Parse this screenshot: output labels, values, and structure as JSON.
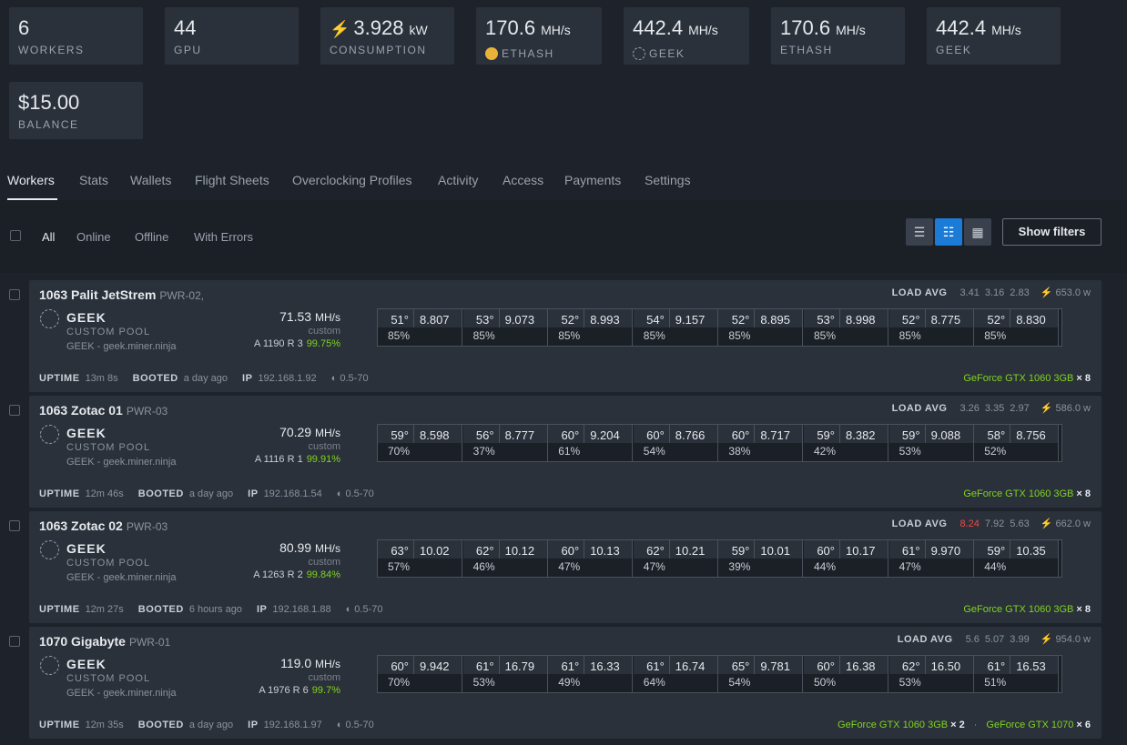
{
  "stats": [
    {
      "value": "6",
      "unit": "",
      "label": "WORKERS",
      "icon": ""
    },
    {
      "value": "44",
      "unit": "",
      "label": "GPU",
      "icon": ""
    },
    {
      "value": "3.928",
      "unit": "kW",
      "label": "CONSUMPTION",
      "icon": "bolt-icon"
    },
    {
      "value": "170.6",
      "unit": "MH/s",
      "label": "ETHASH",
      "icon": "ethash-coin-icon"
    },
    {
      "value": "442.4",
      "unit": "MH/s",
      "label": "GEEK",
      "icon": "geek-coin-icon"
    },
    {
      "value": "170.6",
      "unit": "MH/s",
      "label": "ETHASH",
      "icon": ""
    },
    {
      "value": "442.4",
      "unit": "MH/s",
      "label": "GEEK",
      "icon": ""
    },
    {
      "value": "$15.00",
      "unit": "",
      "label": "BALANCE",
      "icon": ""
    }
  ],
  "tabs": [
    "Workers",
    "Stats",
    "Wallets",
    "Flight Sheets",
    "Overclocking Profiles",
    "Activity",
    "Access",
    "Payments",
    "Settings"
  ],
  "filters": [
    "All",
    "Online",
    "Offline",
    "With Errors"
  ],
  "show_filters_label": "Show filters",
  "labels": {
    "load_avg": "LOAD AVG",
    "uptime": "UPTIME",
    "booted": "BOOTED",
    "ip": "IP",
    "custom": "custom"
  },
  "workers": [
    {
      "name": "1063 Palit JetStrem",
      "tag": "PWR-02,",
      "coin": "GEEK",
      "pool": "CUSTOM POOL",
      "pool_url": "GEEK - geek.miner.ninja",
      "hashrate": "71.53",
      "hashrate_unit": "MH/s",
      "accepted": "A 1190",
      "rejected": "R 3",
      "ratio": "99.75%",
      "load": [
        "3.41",
        "3.16",
        "2.83"
      ],
      "load_high": [
        false,
        false,
        false
      ],
      "power": "653.0 w",
      "gpus": [
        [
          "51°",
          "8.807",
          "85%"
        ],
        [
          "53°",
          "9.073",
          "85%"
        ],
        [
          "52°",
          "8.993",
          "85%"
        ],
        [
          "54°",
          "9.157",
          "85%"
        ],
        [
          "52°",
          "8.895",
          "85%"
        ],
        [
          "53°",
          "8.998",
          "85%"
        ],
        [
          "52°",
          "8.775",
          "85%"
        ],
        [
          "52°",
          "8.830",
          "85%"
        ]
      ],
      "uptime": "13m 8s",
      "booted": "a day ago",
      "ip": "192.168.1.92",
      "oc": "0.5-70",
      "models": [
        {
          "name": "GeForce GTX 1060 3GB",
          "count": "× 8"
        }
      ]
    },
    {
      "name": "1063 Zotac 01",
      "tag": "PWR-03",
      "coin": "GEEK",
      "pool": "CUSTOM POOL",
      "pool_url": "GEEK - geek.miner.ninja",
      "hashrate": "70.29",
      "hashrate_unit": "MH/s",
      "accepted": "A 1116",
      "rejected": "R 1",
      "ratio": "99.91%",
      "load": [
        "3.26",
        "3.35",
        "2.97"
      ],
      "load_high": [
        false,
        false,
        false
      ],
      "power": "586.0 w",
      "gpus": [
        [
          "59°",
          "8.598",
          "70%"
        ],
        [
          "56°",
          "8.777",
          "37%"
        ],
        [
          "60°",
          "9.204",
          "61%"
        ],
        [
          "60°",
          "8.766",
          "54%"
        ],
        [
          "60°",
          "8.717",
          "38%"
        ],
        [
          "59°",
          "8.382",
          "42%"
        ],
        [
          "59°",
          "9.088",
          "53%"
        ],
        [
          "58°",
          "8.756",
          "52%"
        ]
      ],
      "uptime": "12m 46s",
      "booted": "a day ago",
      "ip": "192.168.1.54",
      "oc": "0.5-70",
      "models": [
        {
          "name": "GeForce GTX 1060 3GB",
          "count": "× 8"
        }
      ]
    },
    {
      "name": "1063 Zotac 02",
      "tag": "PWR-03",
      "coin": "GEEK",
      "pool": "CUSTOM POOL",
      "pool_url": "GEEK - geek.miner.ninja",
      "hashrate": "80.99",
      "hashrate_unit": "MH/s",
      "accepted": "A 1263",
      "rejected": "R 2",
      "ratio": "99.84%",
      "load": [
        "8.24",
        "7.92",
        "5.63"
      ],
      "load_high": [
        true,
        false,
        false
      ],
      "power": "662.0 w",
      "gpus": [
        [
          "63°",
          "10.02",
          "57%"
        ],
        [
          "62°",
          "10.12",
          "46%"
        ],
        [
          "60°",
          "10.13",
          "47%"
        ],
        [
          "62°",
          "10.21",
          "47%"
        ],
        [
          "59°",
          "10.01",
          "39%"
        ],
        [
          "60°",
          "10.17",
          "44%"
        ],
        [
          "61°",
          "9.970",
          "47%"
        ],
        [
          "59°",
          "10.35",
          "44%"
        ]
      ],
      "uptime": "12m 27s",
      "booted": "6 hours ago",
      "ip": "192.168.1.88",
      "oc": "0.5-70",
      "models": [
        {
          "name": "GeForce GTX 1060 3GB",
          "count": "× 8"
        }
      ]
    },
    {
      "name": "1070 Gigabyte",
      "tag": "PWR-01",
      "coin": "GEEK",
      "pool": "CUSTOM POOL",
      "pool_url": "GEEK - geek.miner.ninja",
      "hashrate": "119.0",
      "hashrate_unit": "MH/s",
      "accepted": "A 1976",
      "rejected": "R 6",
      "ratio": "99.7%",
      "load": [
        "5.6",
        "5.07",
        "3.99"
      ],
      "load_high": [
        false,
        false,
        false
      ],
      "power": "954.0 w",
      "gpus": [
        [
          "60°",
          "9.942",
          "70%"
        ],
        [
          "61°",
          "16.79",
          "53%"
        ],
        [
          "61°",
          "16.33",
          "49%"
        ],
        [
          "61°",
          "16.74",
          "64%"
        ],
        [
          "65°",
          "9.781",
          "54%"
        ],
        [
          "60°",
          "16.38",
          "50%"
        ],
        [
          "62°",
          "16.50",
          "53%"
        ],
        [
          "61°",
          "16.53",
          "51%"
        ]
      ],
      "uptime": "12m 35s",
      "booted": "a day ago",
      "ip": "192.168.1.97",
      "oc": "0.5-70",
      "models": [
        {
          "name": "GeForce GTX 1060 3GB",
          "count": "× 2"
        },
        {
          "name": "GeForce GTX 1070",
          "count": "× 6"
        }
      ]
    }
  ]
}
